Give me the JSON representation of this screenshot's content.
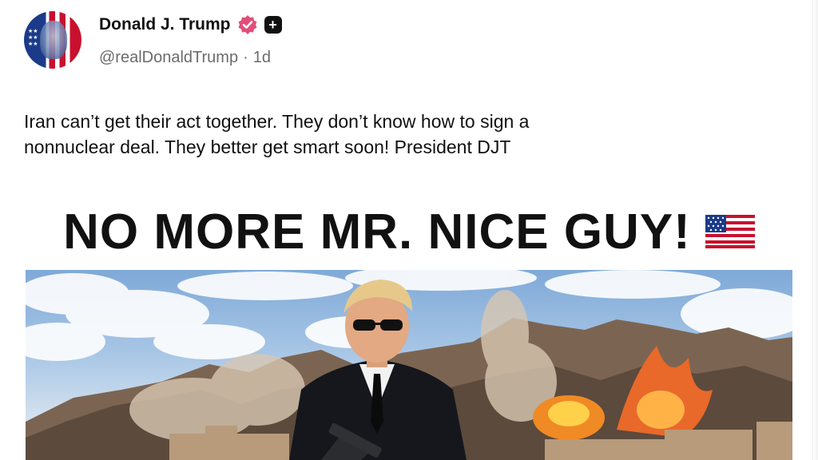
{
  "author": {
    "display_name": "Donald J. Trump",
    "handle": "@realDonaldTrump",
    "separator": "·",
    "time": "1d",
    "verified_icon": "verified-badge-icon",
    "plus_icon": "plus-badge-icon",
    "verified_color": "#e04e7a"
  },
  "post": {
    "line1": "Iran can’t get their act together. They don’t know how to sign a",
    "line2": "nonnuclear deal. They better get smart soon! President DJT"
  },
  "image": {
    "headline": "NO MORE MR. NICE GUY!",
    "flag_icon": "us-flag-icon"
  }
}
